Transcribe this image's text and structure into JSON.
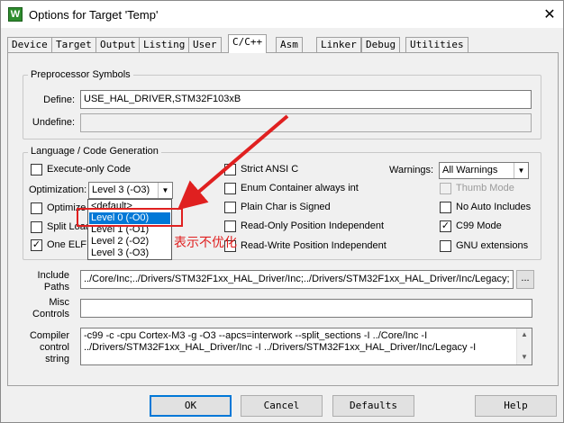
{
  "window": {
    "title": "Options for Target 'Temp'",
    "close_glyph": "✕",
    "icon_letter": "W"
  },
  "tabs": [
    {
      "label": "Device"
    },
    {
      "label": "Target"
    },
    {
      "label": "Output"
    },
    {
      "label": "Listing"
    },
    {
      "label": "User"
    },
    {
      "label": "C/C++"
    },
    {
      "label": "Asm"
    },
    {
      "label": "Linker"
    },
    {
      "label": "Debug"
    },
    {
      "label": "Utilities"
    }
  ],
  "active_tab": "C/C++",
  "preprocessor": {
    "title": "Preprocessor Symbols",
    "define_label": "Define:",
    "define_value": "USE_HAL_DRIVER,STM32F103xB",
    "undefine_label": "Undefine:",
    "undefine_value": ""
  },
  "language": {
    "title": "Language / Code Generation",
    "execute_only": {
      "label": "Execute-only Code",
      "checked": false
    },
    "optimization_label": "Optimization:",
    "optimization_value": "Level 3 (-O3)",
    "optimize_for_time": {
      "label": "Optimize f",
      "checked": false
    },
    "split_load": {
      "label": "Split Load",
      "checked": false
    },
    "one_elf": {
      "label": "One ELF",
      "checked": true
    },
    "strict_ansi": {
      "label": "Strict ANSI C",
      "checked": false
    },
    "enum_container": {
      "label": "Enum Container always int",
      "checked": false
    },
    "plain_char": {
      "label": "Plain Char is Signed",
      "checked": false
    },
    "ro_position": {
      "label": "Read-Only Position Independent",
      "checked": false
    },
    "rw_position": {
      "label": "Read-Write Position Independent",
      "checked": false
    },
    "warnings_label": "Warnings:",
    "warnings_value": "All Warnings",
    "thumb_mode": {
      "label": "Thumb Mode",
      "checked": false,
      "disabled": true
    },
    "no_auto_includes": {
      "label": "No Auto Includes",
      "checked": false
    },
    "c99_mode": {
      "label": "C99 Mode",
      "checked": true
    },
    "gnu_extensions": {
      "label": "GNU extensions",
      "checked": false
    },
    "check_glyph": "✓"
  },
  "optimization_dropdown": {
    "options": [
      "<default>",
      "Level 0 (-O0)",
      "Level 1 (-O1)",
      "Level 2 (-O2)",
      "Level 3 (-O3)"
    ],
    "highlighted": "Level 0 (-O0)"
  },
  "annotation": {
    "text": "表示不优化",
    "color": "#e02020"
  },
  "include_paths": {
    "label_line1": "Include",
    "label_line2": "Paths",
    "value": "../Core/Inc;../Drivers/STM32F1xx_HAL_Driver/Inc;../Drivers/STM32F1xx_HAL_Driver/Inc/Legacy;",
    "browse_label": "..."
  },
  "misc_controls": {
    "label_line1": "Misc",
    "label_line2": "Controls",
    "value": ""
  },
  "compiler_control": {
    "label_line1": "Compiler",
    "label_line2": "control",
    "label_line3": "string",
    "line1": "-c99 -c -cpu Cortex-M3 -g -O3 --apcs=interwork --split_sections -I ../Core/Inc -I",
    "line2": "../Drivers/STM32F1xx_HAL_Driver/Inc -I ../Drivers/STM32F1xx_HAL_Driver/Inc/Legacy -I"
  },
  "buttons": {
    "ok": "OK",
    "cancel": "Cancel",
    "defaults": "Defaults",
    "help": "Help"
  },
  "colors": {
    "highlight": "#0078d7",
    "annotation_red": "#e02020",
    "dialog_bg": "#f0f0f0"
  }
}
